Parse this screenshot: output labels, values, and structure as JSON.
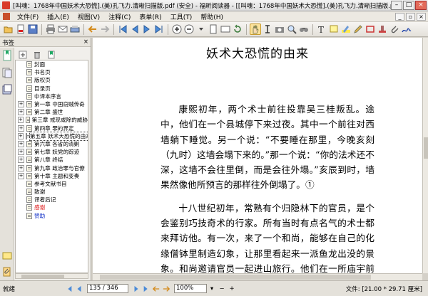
{
  "window": {
    "title": "[叫魂：1768年中国妖术大恐慌].(美)孔飞力.清晰扫描版.pdf (安全) - 福昕阅读器 - [[叫魂：1768年中国妖术大恐慌].(美)孔飞力.清晰扫描版.pdf (安全)]"
  },
  "menu": [
    "文件(F)",
    "插入(E)",
    "视图(V)",
    "注释(C)",
    "表单(R)",
    "工具(T)",
    "帮助(H)"
  ],
  "left_panel": {
    "header": "书签",
    "tree": [
      {
        "label": "封面",
        "expandable": false
      },
      {
        "label": "书名页",
        "expandable": false
      },
      {
        "label": "版权页",
        "expandable": false
      },
      {
        "label": "目录页",
        "expandable": false
      },
      {
        "label": "中译本序言",
        "expandable": false
      },
      {
        "label": "第一章  中国窃贼传奇",
        "expandable": true
      },
      {
        "label": "第二章  盛世",
        "expandable": true
      },
      {
        "label": "第三章  戒现或除的威胁",
        "expandable": true
      },
      {
        "label": "第四章  罪的界定",
        "expandable": true
      },
      {
        "label": "第五章  妖术大恐慌的由来",
        "expandable": true,
        "selected": true
      },
      {
        "label": "第六章  各省的清剿",
        "expandable": true
      },
      {
        "label": "第七章  妖党的踪迹",
        "expandable": true
      },
      {
        "label": "第八章  终结",
        "expandable": true
      },
      {
        "label": "第九章  政治罪与官僚",
        "expandable": true
      },
      {
        "label": "第十章  主题和变奏",
        "expandable": true
      },
      {
        "label": "参考文献书目",
        "expandable": false
      },
      {
        "label": "致谢",
        "expandable": false
      },
      {
        "label": "译者后记",
        "expandable": false
      },
      {
        "label": "感谢",
        "expandable": false,
        "color": "red"
      },
      {
        "label": "赞助",
        "expandable": false,
        "color": "blue"
      }
    ]
  },
  "document": {
    "title": "妖术大恐慌的由来",
    "paragraphs": [
      "康熙初年，两个术士前往投靠吴三桂叛乱。途中，他们在一个县城停下来过夜。其中一个前往对西墙躺下睡觉。另一个说：“不要睡在那里，今晚亥刻（九时）这墙会塌下来的。”那一个说：“你的法术还不深，这墙不会往里倒，而是会往外塌。”亥辰到时，墙果然像他所预言的那样往外倒塌了。①",
      "十八世纪初年，常熟有个归隐林下的官员，是个会鉴别巧技奇术的行家。所有当时有点名气的术士都来拜访他。有一次，来了一个和尚，能够在自己的化缘僧钵里制造幻象，让那里看起来一派鱼龙出没的景象。和尚邀请官员一起进山旅行。他们在一所庙宇前停下休"
    ]
  },
  "status": {
    "left": "就绪",
    "page": "135 / 346",
    "zoom": "100%",
    "right": "文件: [21.00 * 29.71 厘米]"
  }
}
